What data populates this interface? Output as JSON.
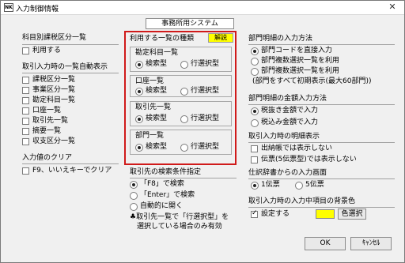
{
  "window": {
    "title": "入力制御情報",
    "icon": "app-icon",
    "close": "✕"
  },
  "system_name": "事務所用システム",
  "left": {
    "section1_title": "科目別課税区分一覧",
    "use_label": "利用する",
    "section2_title": "取引入力時の一覧自動表示",
    "auto_items": [
      "課税区分一覧",
      "事業区分一覧",
      "勘定科目一覧",
      "口座一覧",
      "取引先一覧",
      "摘要一覧",
      "収支区分一覧"
    ],
    "section3_title": "入力値のクリア",
    "clear_label": "F9、いいえキーでクリア"
  },
  "middle": {
    "title": "利用する一覧の種類",
    "help_label": "解説",
    "groups": [
      {
        "title": "勘定科目一覧",
        "opt1": "検索型",
        "opt2": "行選択型"
      },
      {
        "title": "口座一覧",
        "opt1": "検索型",
        "opt2": "行選択型"
      },
      {
        "title": "取引先一覧",
        "opt1": "検索型",
        "opt2": "行選択型"
      },
      {
        "title": "部門一覧",
        "opt1": "検索型",
        "opt2": "行選択型"
      }
    ],
    "search_title": "取引先の検索条件指定",
    "search_opts": [
      "「F8」で検索",
      "「Enter」で検索",
      "自動的に開く"
    ],
    "note_line1": "♣取引先一覧で「行選択型」を",
    "note_line2": "選択している場合のみ有効"
  },
  "right": {
    "dept_title": "部門明細の入力方法",
    "dept_opts": [
      "部門コードを直接入力",
      "部門複数選択一覧を利用",
      "部門複数選択一覧を利用"
    ],
    "dept_note": "(部門をすべて初期表示(最大60部門))",
    "amount_title": "部門明細の金額入力方法",
    "amount_opts": [
      "税抜き金額で入力",
      "税込み金額で入力"
    ],
    "detail_title": "取引入力時の明細表示",
    "detail_opts": [
      "出納帳では表示しない",
      "伝票(5伝票型)では表示しない"
    ],
    "journal_title": "仕訳辞書からの入力画面",
    "journal_opt1": "1伝票",
    "journal_opt2": "5伝票",
    "bg_title": "取引入力時の入力中項目の背景色",
    "bg_label": "設定する",
    "bg_color": "#ffff00",
    "color_btn": "色選択"
  },
  "buttons": {
    "ok": "OK",
    "cancel": "ｷｬﾝｾﾙ"
  }
}
